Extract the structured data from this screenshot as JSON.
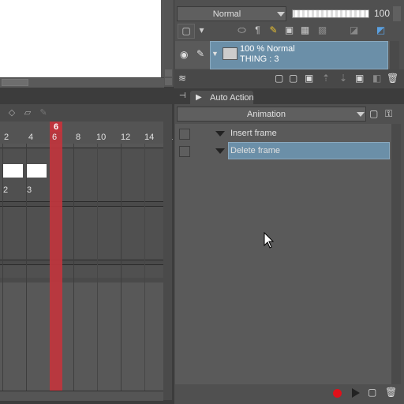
{
  "layer_panel": {
    "blend_mode": "Normal",
    "opacity_value": "100",
    "opacity_fraction": 1.0,
    "layer": {
      "line1": "100 % Normal",
      "line2": "THING : 3"
    }
  },
  "auto_action": {
    "tab_label": "Auto Action",
    "set_name": "Animation",
    "items": [
      {
        "label": "Insert frame",
        "selected": false
      },
      {
        "label": "Delete frame",
        "selected": true
      }
    ]
  },
  "timeline": {
    "ruler_labels": [
      "2",
      "4",
      "6",
      "8",
      "10",
      "12",
      "14",
      "1"
    ],
    "current_frame": "6",
    "cel_labels": [
      "2",
      "3"
    ]
  },
  "colors": {
    "selection": "#6b8fa8",
    "playhead": "#c0353d",
    "record": "#e0101a"
  },
  "icons": [
    "eye-icon",
    "pen-icon",
    "folder-icon",
    "record-icon",
    "play-icon",
    "new-set-icon",
    "delete-icon",
    "chevron-down-icon"
  ]
}
